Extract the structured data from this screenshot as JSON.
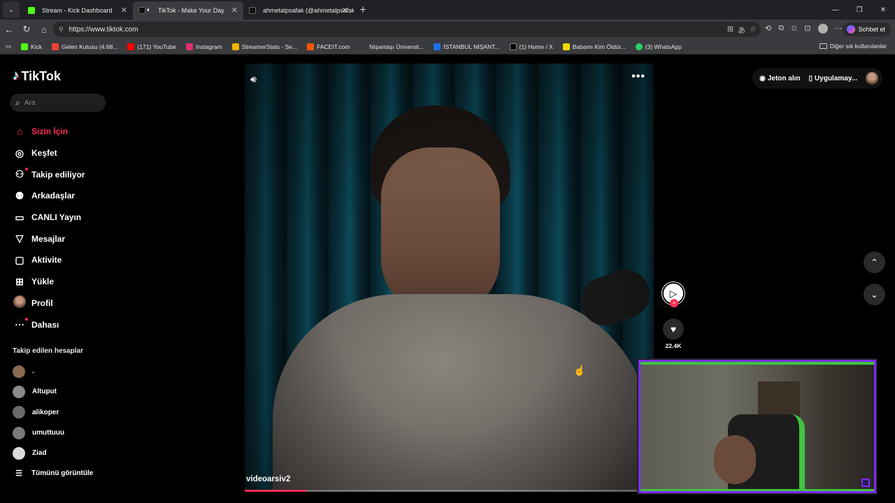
{
  "browser": {
    "tabs": [
      {
        "title": "Stream - Kick Dashboard",
        "favicon_color": "#53fc18",
        "active": false,
        "audio": false
      },
      {
        "title": "TikTok - Make Your Day",
        "favicon_color": "#111111",
        "active": true,
        "audio": true
      },
      {
        "title": "ahmetalpsafak (@ahmetalpsafak) |",
        "favicon_color": "#111111",
        "active": false,
        "audio": false
      }
    ],
    "new_tab_glyph": "+",
    "url": "https://www.tiktok.com",
    "copilot_label": "Sohbet et",
    "bookmarks": [
      {
        "label": "Kick",
        "color": "#53fc18"
      },
      {
        "label": "Gelen Kutusu (4.68...",
        "color": "#ea4335"
      },
      {
        "label": "(171) YouTube",
        "color": "#ff0000"
      },
      {
        "label": "Instagram",
        "color": "#e1306c"
      },
      {
        "label": "StreamerStats - Se...",
        "color": "#f5b400"
      },
      {
        "label": "FACEIT.com",
        "color": "#ff5500"
      },
      {
        "label": "Nişantaşı Üniversit...",
        "color": "#3a3b3e"
      },
      {
        "label": "İSTANBUL NİŞANT...",
        "color": "#1a73e8"
      },
      {
        "label": "(1) Home / X",
        "color": "#000000"
      },
      {
        "label": "Babamı Kim Öldür...",
        "color": "#f5d800"
      },
      {
        "label": "(3) WhatsApp",
        "color": "#25d366"
      }
    ],
    "bookmarks_folder": "Diğer sık kullanılanlar"
  },
  "tiktok": {
    "logo": "TikTok",
    "search_placeholder": "Ara",
    "nav": [
      {
        "label": "Sizin İçin",
        "icon": "home-icon",
        "glyph": "⌂",
        "active": true
      },
      {
        "label": "Keşfet",
        "icon": "compass-icon",
        "glyph": "◎",
        "active": false
      },
      {
        "label": "Takip ediliyor",
        "icon": "following-icon",
        "glyph": "⚇",
        "active": false,
        "dot": true
      },
      {
        "label": "Arkadaşlar",
        "icon": "friends-icon",
        "glyph": "⚉",
        "active": false
      },
      {
        "label": "CANLI Yayın",
        "icon": "live-icon",
        "glyph": "▭",
        "active": false
      },
      {
        "label": "Mesajlar",
        "icon": "messages-icon",
        "glyph": "▽",
        "active": false
      },
      {
        "label": "Aktivite",
        "icon": "activity-icon",
        "glyph": "▢",
        "active": false
      },
      {
        "label": "Yükle",
        "icon": "upload-icon",
        "glyph": "⊞",
        "active": false
      },
      {
        "label": "Profil",
        "icon": "profile-avatar",
        "glyph": "",
        "active": false
      },
      {
        "label": "Dahası",
        "icon": "more-icon",
        "glyph": "⋯",
        "active": false,
        "dot": true
      }
    ],
    "following_title": "Takip edilen hesaplar",
    "following": [
      {
        "name": ".",
        "color": "#8a6a50"
      },
      {
        "name": "Altuput",
        "color": "#8a8a8a"
      },
      {
        "name": "alikoper",
        "color": "#6a6a6a"
      },
      {
        "name": "umuttuuu",
        "color": "#7a7a7a"
      },
      {
        "name": "Ziad",
        "color": "#dcdcdc"
      }
    ],
    "see_all": "Tümünü görüntüle",
    "top_right": {
      "coins": "Jeton alın",
      "app": "Uygulamay..."
    },
    "video": {
      "author": "videoarsiv2",
      "progress": 0.15,
      "like_count": "22.4K"
    }
  }
}
